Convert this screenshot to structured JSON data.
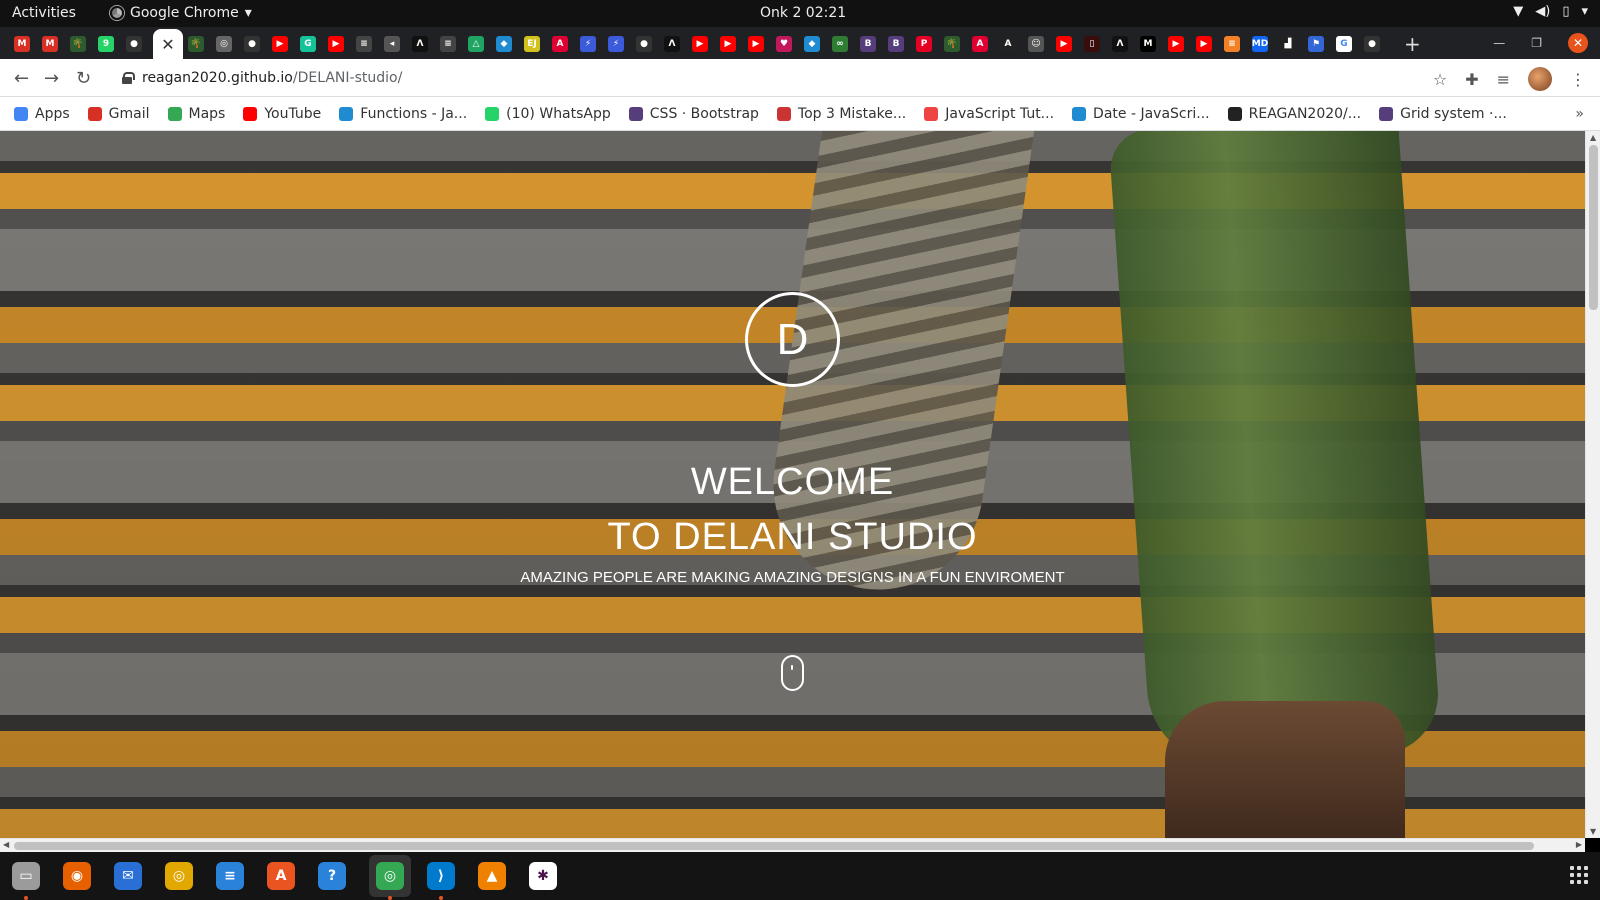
{
  "os": {
    "activities_label": "Activities",
    "app_menu_label": "Google Chrome",
    "clock": "Onk 2  02:21"
  },
  "browser": {
    "url_host": "reagan2020.github.io",
    "url_path": "/DELANI-studio/",
    "active_tab_close": "✕",
    "new_tab": "+"
  },
  "bookmarks": [
    {
      "label": "Apps",
      "icon": "apps-grid-icon",
      "color": "#4285f4"
    },
    {
      "label": "Gmail",
      "icon": "gmail-icon",
      "color": "#d93025"
    },
    {
      "label": "Maps",
      "icon": "maps-icon",
      "color": "#34a853"
    },
    {
      "label": "YouTube",
      "icon": "youtube-icon",
      "color": "#ff0000"
    },
    {
      "label": "Functions - Ja...",
      "icon": "mdn-icon",
      "color": "#1f8bd0"
    },
    {
      "label": "(10) WhatsApp",
      "icon": "whatsapp-icon",
      "color": "#25d366"
    },
    {
      "label": "CSS · Bootstrap",
      "icon": "bootstrap-icon",
      "color": "#563d7c"
    },
    {
      "label": "Top 3 Mistake...",
      "icon": "w-icon",
      "color": "#c33"
    },
    {
      "label": "JavaScript Tut...",
      "icon": "spiral-icon",
      "color": "#e44"
    },
    {
      "label": "Date - JavaScri...",
      "icon": "mdn-icon",
      "color": "#1f8bd0"
    },
    {
      "label": "REAGAN2020/...",
      "icon": "github-icon",
      "color": "#222"
    },
    {
      "label": "Grid system ·...",
      "icon": "bootstrap-icon",
      "color": "#563d7c"
    }
  ],
  "hero": {
    "logo_letter": "D",
    "welcome": "WELCOME",
    "studio": "TO DELANI STUDIO",
    "tagline": "AMAZING PEOPLE ARE MAKING AMAZING DESIGNS IN A FUN ENVIROMENT"
  },
  "tabs": [
    {
      "icon": "gmail-icon",
      "color": "#d93025",
      "glyph": "M"
    },
    {
      "icon": "gmail-icon",
      "color": "#d93025",
      "glyph": "M"
    },
    {
      "icon": "palm-icon",
      "color": "#2e5b2e",
      "glyph": "🌴"
    },
    {
      "icon": "whatsapp-icon",
      "color": "#25d366",
      "glyph": "9"
    },
    {
      "icon": "github-icon",
      "color": "#333",
      "glyph": "●"
    },
    {
      "icon": "palm-icon",
      "color": "#2e5b2e",
      "glyph": "🌴"
    },
    {
      "icon": "globe-icon",
      "color": "#666",
      "glyph": "◎"
    },
    {
      "icon": "github-icon",
      "color": "#333",
      "glyph": "●"
    },
    {
      "icon": "youtube-icon",
      "color": "#ff0000",
      "glyph": "▶"
    },
    {
      "icon": "grammarly-icon",
      "color": "#15c39a",
      "glyph": "G"
    },
    {
      "icon": "youtube-icon",
      "color": "#ff0000",
      "glyph": "▶"
    },
    {
      "icon": "stackoverflow-icon",
      "color": "#444",
      "glyph": "≡"
    },
    {
      "icon": "mute-icon",
      "color": "#555",
      "glyph": "◂"
    },
    {
      "icon": "codepen-icon",
      "color": "#111",
      "glyph": "Λ"
    },
    {
      "icon": "stackoverflow-icon",
      "color": "#444",
      "glyph": "≡"
    },
    {
      "icon": "drive-icon",
      "color": "#1fa463",
      "glyph": "△"
    },
    {
      "icon": "mdn-icon",
      "color": "#1f8bd0",
      "glyph": "◆"
    },
    {
      "icon": "ejs-icon",
      "color": "#d4c21c",
      "glyph": "EJ"
    },
    {
      "icon": "angular-icon",
      "color": "#dd0031",
      "glyph": "A"
    },
    {
      "icon": "bolt-icon",
      "color": "#3b5bdb",
      "glyph": "⚡"
    },
    {
      "icon": "bolt-icon",
      "color": "#3b5bdb",
      "glyph": "⚡"
    },
    {
      "icon": "github-icon",
      "color": "#333",
      "glyph": "●"
    },
    {
      "icon": "codepen-icon",
      "color": "#111",
      "glyph": "Λ"
    },
    {
      "icon": "youtube-icon",
      "color": "#ff0000",
      "glyph": "▶"
    },
    {
      "icon": "youtube-icon",
      "color": "#ff0000",
      "glyph": "▶"
    },
    {
      "icon": "youtube-icon",
      "color": "#ff0000",
      "glyph": "▶"
    },
    {
      "icon": "heart-icon",
      "color": "#c2185b",
      "glyph": "♥"
    },
    {
      "icon": "mdn-icon",
      "color": "#1f8bd0",
      "glyph": "◆"
    },
    {
      "icon": "code-icon",
      "color": "#2e7d32",
      "glyph": "∞"
    },
    {
      "icon": "bootstrap-icon",
      "color": "#563d7c",
      "glyph": "B"
    },
    {
      "icon": "bootstrap-icon",
      "color": "#563d7c",
      "glyph": "B"
    },
    {
      "icon": "pinterest-icon",
      "color": "#e60023",
      "glyph": "P"
    },
    {
      "icon": "palm-icon",
      "color": "#2e5b2e",
      "glyph": "🌴"
    },
    {
      "icon": "angular-icon",
      "color": "#dd0031",
      "glyph": "A"
    },
    {
      "icon": "a-icon",
      "color": "#222",
      "glyph": "A"
    },
    {
      "icon": "incognito-icon",
      "color": "#555",
      "glyph": "☺"
    },
    {
      "icon": "youtube-icon",
      "color": "#ff0000",
      "glyph": "▶"
    },
    {
      "icon": "dark-icon",
      "color": "#3a0d0d",
      "glyph": "▯"
    },
    {
      "icon": "codepen-icon",
      "color": "#111",
      "glyph": "Λ"
    },
    {
      "icon": "medium-icon",
      "color": "#000",
      "glyph": "M"
    },
    {
      "icon": "youtube-icon",
      "color": "#ff0000",
      "glyph": "▶"
    },
    {
      "icon": "youtube-icon",
      "color": "#ff0000",
      "glyph": "▶"
    },
    {
      "icon": "stackoverflow-icon",
      "color": "#f48024",
      "glyph": "≡"
    },
    {
      "icon": "mdb-icon",
      "color": "#1266f1",
      "glyph": "MD"
    },
    {
      "icon": "dark-icon",
      "color": "#222",
      "glyph": "▟"
    },
    {
      "icon": "flag-icon",
      "color": "#3367d6",
      "glyph": "⚑"
    },
    {
      "icon": "google-icon",
      "color": "#fff",
      "glyph": "G"
    },
    {
      "icon": "github-icon",
      "color": "#333",
      "glyph": "●"
    }
  ],
  "dock": [
    {
      "icon": "files-icon",
      "color": "#9b9b9b",
      "glyph": "▭",
      "running": true
    },
    {
      "icon": "firefox-icon",
      "color": "#e66000",
      "glyph": "◉",
      "running": false
    },
    {
      "icon": "thunderbird-icon",
      "color": "#2a6fd6",
      "glyph": "✉",
      "running": false
    },
    {
      "icon": "rhythmbox-icon",
      "color": "#e0a800",
      "glyph": "◎",
      "running": false
    },
    {
      "icon": "writer-icon",
      "color": "#2b82d9",
      "glyph": "≡",
      "running": false
    },
    {
      "icon": "software-icon",
      "color": "#e95420",
      "glyph": "A",
      "running": false
    },
    {
      "icon": "help-icon",
      "color": "#2b82d9",
      "glyph": "?",
      "running": false
    },
    {
      "icon": "chrome-icon",
      "color": "#34a853",
      "glyph": "◎",
      "running": true
    },
    {
      "icon": "vscode-icon",
      "color": "#007acc",
      "glyph": "⟩",
      "running": true
    },
    {
      "icon": "vlc-icon",
      "color": "#f08000",
      "glyph": "▲",
      "running": false
    },
    {
      "icon": "slack-icon",
      "color": "#fff",
      "glyph": "✱",
      "running": false
    }
  ]
}
